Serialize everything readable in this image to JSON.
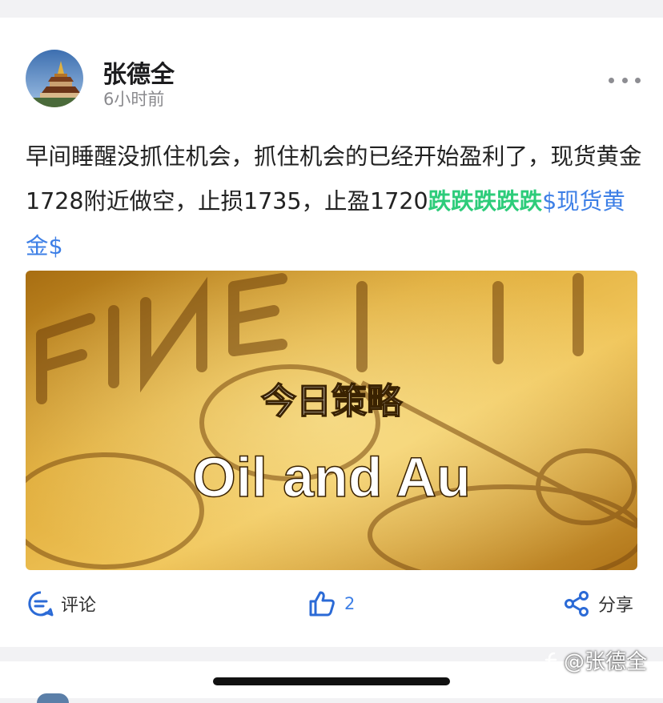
{
  "post": {
    "author": "张德全",
    "time": "6小时前",
    "text_before_emoji": "早间睡醒没抓住机会，抓住机会的已经开始盈利了，现货黄金1728附近做空，止损1735，止盈1720",
    "emoji_text": "跌跌跌跌跌",
    "hashtag": "$现货黄金$",
    "image": {
      "overlay_title": "今日策略",
      "overlay_subtitle": "Oil and Au",
      "bar_stamp": "FINE"
    }
  },
  "actions": {
    "comment_label": "评论",
    "like_count": "2",
    "share_label": "分享"
  },
  "watermark": "@张德全",
  "colors": {
    "highlight_green": "#2dcc7a",
    "link_blue": "#3d7fe6",
    "gold": "#c8901e"
  },
  "icons": {
    "more": "more-horizontal-icon",
    "comment": "comment-icon",
    "like": "thumbs-up-icon",
    "share": "share-icon"
  }
}
